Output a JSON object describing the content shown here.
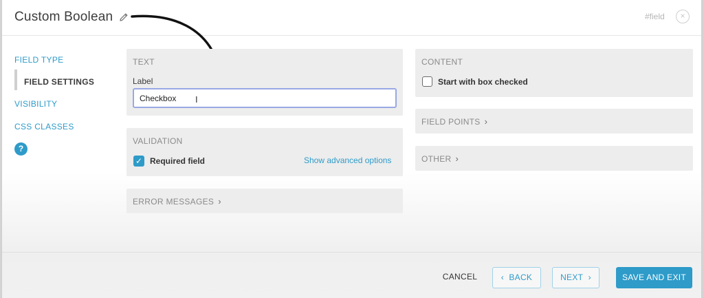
{
  "header": {
    "title": "Custom Boolean",
    "tag": "#field",
    "close_glyph": "×"
  },
  "sidebar": {
    "items": [
      {
        "label": "FIELD TYPE"
      },
      {
        "label": "FIELD SETTINGS"
      },
      {
        "label": "VISIBILITY"
      },
      {
        "label": "CSS CLASSES"
      }
    ],
    "active_index": 1,
    "help_glyph": "?"
  },
  "text_panel": {
    "title": "TEXT",
    "label_caption": "Label",
    "label_value": "Checkbox"
  },
  "validation_panel": {
    "title": "VALIDATION",
    "required_label": "Required field",
    "required_checked": true,
    "advanced_link": "Show advanced options"
  },
  "error_messages_panel": {
    "title": "ERROR MESSAGES"
  },
  "content_panel": {
    "title": "CONTENT",
    "checkbox_label": "Start with box checked",
    "checked": false
  },
  "field_points_panel": {
    "title": "FIELD POINTS"
  },
  "other_panel": {
    "title": "OTHER"
  },
  "footer": {
    "cancel": "CANCEL",
    "back": "BACK",
    "next": "NEXT",
    "save": "SAVE AND EXIT"
  },
  "colors": {
    "accent": "#2e9bc9",
    "panel_bg": "#ededed",
    "input_focus_border": "#98a8e4"
  },
  "icons": {
    "pencil": "pencil-icon",
    "close": "close-circle-icon",
    "help": "help-circle-icon",
    "chevron_right": "chevron-right-icon",
    "chevron_left": "chevron-left-icon",
    "annotation_arrow": "curved-arrow-icon"
  }
}
